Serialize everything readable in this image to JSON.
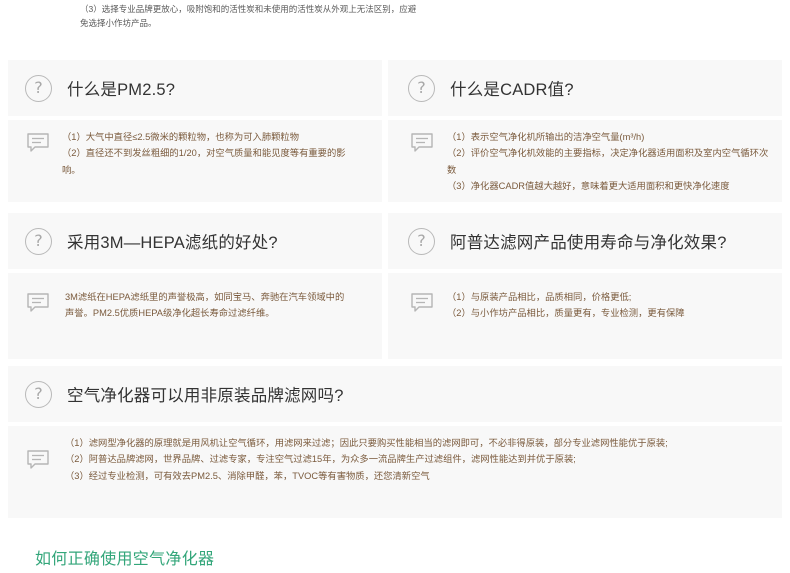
{
  "top_note": {
    "line1": "（3）选择专业品牌更放心，吸附饱和的活性炭和未使用的活性炭从外观上无法区别，应避",
    "line2": "免选择小作坊产品。"
  },
  "faq": [
    {
      "question": "什么是PM2.5?",
      "answer": [
        "（1）大气中直径≤2.5微米的颗粒物，也称为可入肺颗粒物",
        "（2）直径还不到发丝粗细的1/20，对空气质量和能见度等有重要的影响。"
      ]
    },
    {
      "question": "什么是CADR值?",
      "answer": [
        "（1）表示空气净化机所输出的洁净空气量(m³/h)",
        "（2）评价空气净化机效能的主要指标，决定净化器适用面积及室内空气循环次数",
        "（3）净化器CADR值越大越好，意味着更大适用面积和更快净化速度"
      ]
    },
    {
      "question": "采用3M—HEPA滤纸的好处?",
      "answer": [
        "3M滤纸在HEPA滤纸里的声誉极高，如同宝马、奔驰在汽车领域中的声誉。PM2.5优质HEPA级净化超长寿命过滤纤维。"
      ]
    },
    {
      "question": "阿普达滤网产品使用寿命与净化效果?",
      "answer": [
        "（1）与原装产品相比，品质相同，价格更低;",
        "（2）与小作坊产品相比，质量更有，专业检测，更有保障"
      ]
    },
    {
      "question": "空气净化器可以用非原装品牌滤网吗?",
      "answer": [
        "（1）滤网型净化器的原理就是用风机让空气循环，用滤网来过滤；因此只要购买性能相当的滤网即可，不必非得原装，部分专业滤网性能优于原装;",
        "（2）阿普达品牌滤网，世界品牌、过滤专家，专注空气过滤15年，为众多一流品牌生产过滤组件，滤网性能达到并优于原装;",
        "（3）经过专业检测，可有效去PM2.5、消除甲醛，苯，TVOC等有害物质，还您清新空气"
      ]
    }
  ],
  "footer_title": "如何正确使用空气净化器",
  "icons": {
    "question": "question-circle-icon",
    "answer": "speech-bubble-icon"
  },
  "colors": {
    "answer_text": "#7a5a3c",
    "footer_title": "#33a67a",
    "card_bg": "#f8f8f8"
  }
}
